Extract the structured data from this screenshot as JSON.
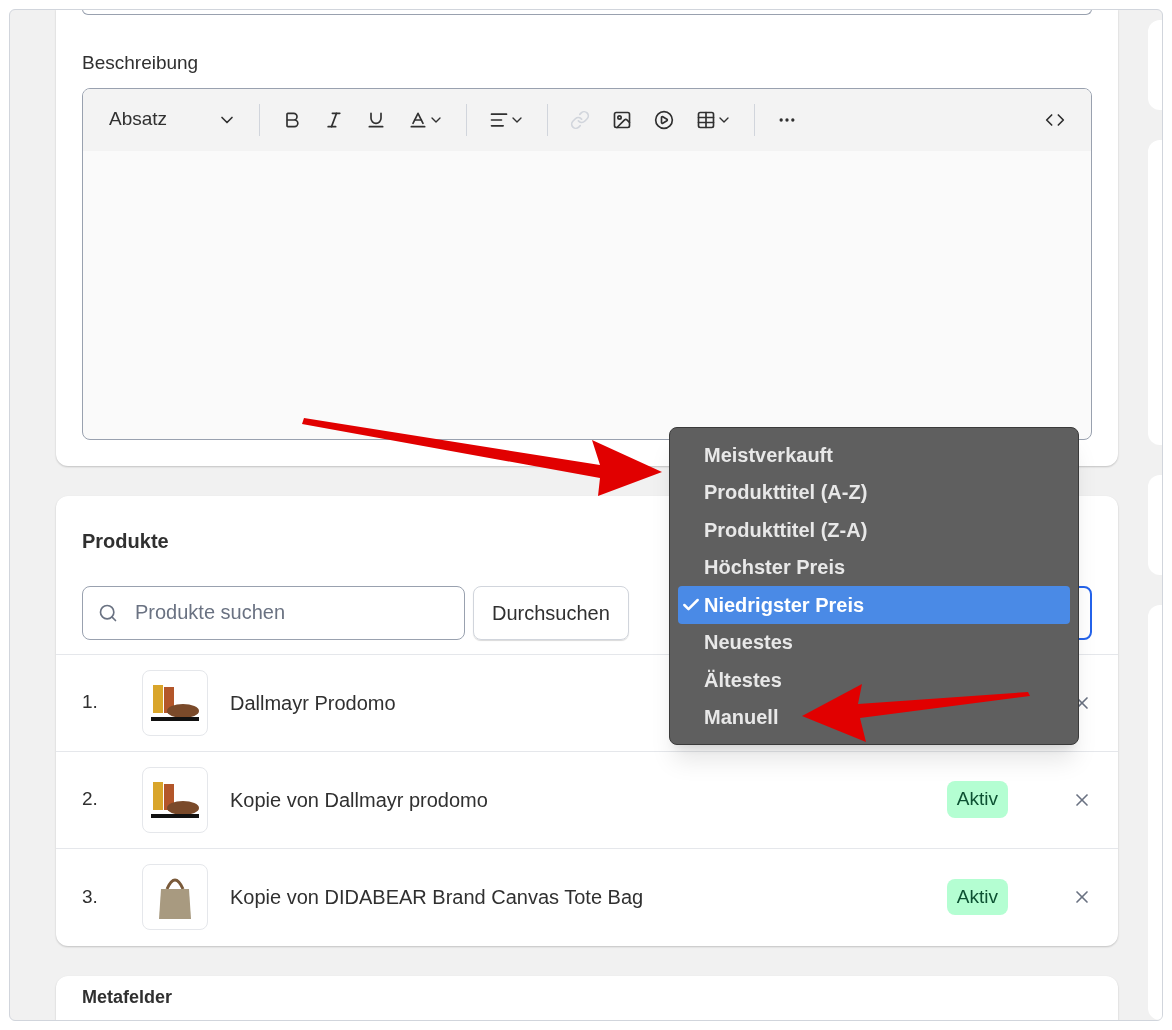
{
  "description": {
    "label": "Beschreibung",
    "toolbar": {
      "block_style": "Absatz"
    }
  },
  "products": {
    "title": "Produkte",
    "search": {
      "placeholder": "Produkte suchen"
    },
    "browse_button": "Durchsuchen",
    "sort_menu": [
      {
        "label": "Meistverkauft",
        "selected": false
      },
      {
        "label": "Produkttitel (A-Z)",
        "selected": false
      },
      {
        "label": "Produkttitel (Z-A)",
        "selected": false
      },
      {
        "label": "Höchster Preis",
        "selected": false
      },
      {
        "label": "Niedrigster Preis",
        "selected": true
      },
      {
        "label": "Neuestes",
        "selected": false
      },
      {
        "label": "Ältestes",
        "selected": false
      },
      {
        "label": "Manuell",
        "selected": false
      }
    ],
    "items": [
      {
        "index": "1.",
        "name": "Dallmayr Prodomo",
        "kind": "coffee"
      },
      {
        "index": "2.",
        "name": "Kopie von Dallmayr prodomo",
        "kind": "coffee",
        "status": "Aktiv"
      },
      {
        "index": "3.",
        "name": "Kopie von DIDABEAR Brand Canvas Tote Bag",
        "kind": "bag",
        "status": "Aktiv"
      }
    ]
  },
  "metafields": {
    "title": "Metafelder"
  }
}
